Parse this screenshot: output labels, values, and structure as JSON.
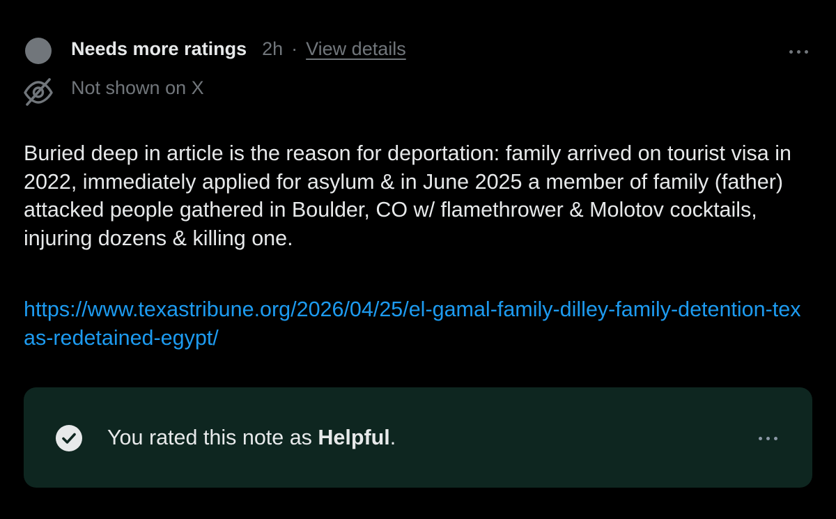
{
  "header": {
    "status_title": "Needs more ratings",
    "time_ago": "2h",
    "separator": "·",
    "view_details_label": "View details"
  },
  "visibility": {
    "icon": "eye-slash-icon",
    "label": "Not shown on X"
  },
  "note": {
    "body": "Buried deep in article is the reason for deportation: family arrived on tourist visa in 2022, immediately applied for asylum & in June 2025 a member of family (father) attacked people gathered in Boulder, CO w/ flamethrower & Molotov cocktails, injuring dozens & killing one.",
    "link": "https://www.texastribune.org/2026/04/25/el-gamal-family-dilley-family-detention-texas-redetained-egypt/"
  },
  "rating": {
    "icon": "check-circle-icon",
    "prefix": "You rated this note as ",
    "value": "Helpful",
    "suffix": "."
  },
  "icons": {
    "more_top": "more-horizontal-icon",
    "more_rating": "more-horizontal-icon"
  },
  "colors": {
    "background": "#000000",
    "primary_text": "#e7e9ea",
    "secondary_text": "#71767b",
    "link": "#1d9bf0",
    "rating_box": "#0e2620"
  }
}
